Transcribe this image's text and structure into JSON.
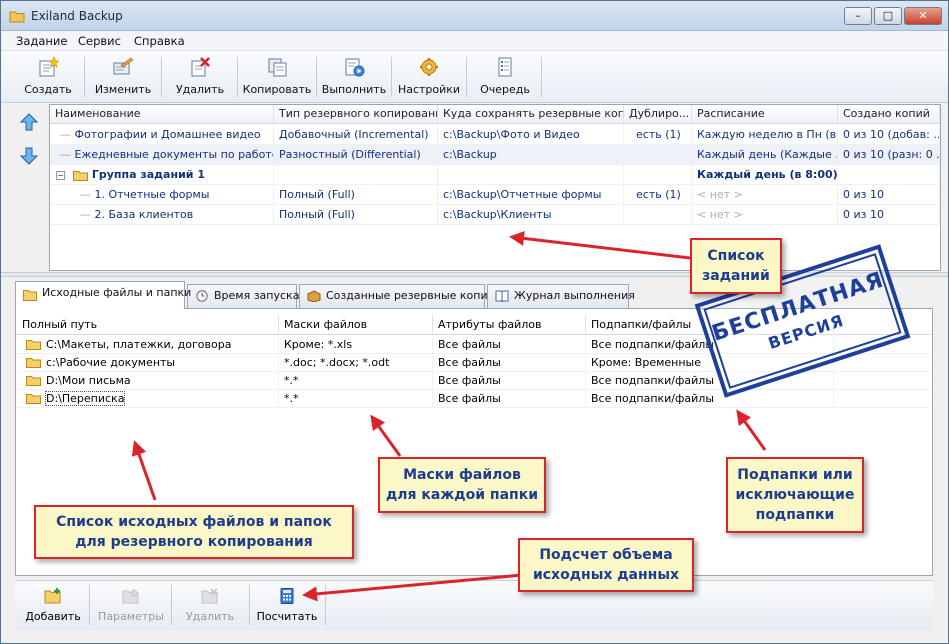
{
  "window": {
    "title": "Exiland Backup"
  },
  "menu": [
    "Задание",
    "Сервис",
    "Справка"
  ],
  "toolbar": {
    "buttons": [
      {
        "label": "Создать",
        "icon": "create-icon"
      },
      {
        "label": "Изменить",
        "icon": "edit-icon"
      },
      {
        "label": "Удалить",
        "icon": "delete-icon"
      },
      {
        "label": "Копировать",
        "icon": "copy-icon"
      },
      {
        "label": "Выполнить",
        "icon": "run-icon"
      },
      {
        "label": "Настройки",
        "icon": "settings-icon"
      },
      {
        "label": "Очередь",
        "icon": "queue-icon"
      }
    ]
  },
  "jobs": {
    "columns": [
      "Наименование",
      "Тип резервного копирования",
      "Куда сохранять резервные копии",
      "Дублиро...",
      "Расписание",
      "Создано копий"
    ],
    "rows": [
      {
        "name": "Фотографии и Домашнее видео",
        "type": "Добавочный (Incremental)",
        "dest": "c:\\Backup\\Фото и Видео",
        "dup": "есть (1)",
        "schedule": "Каждую неделю в Пн (в...",
        "copies": "0 из 10 (добав: ..."
      },
      {
        "name": "Ежедневные документы по работе",
        "type": "Разностный (Differential)",
        "dest": "c:\\Backup",
        "dup": "",
        "schedule": "Каждый день (Каждые ...",
        "copies": "0 из 10 (разн: 0 ..."
      },
      {
        "name": "Группа заданий 1",
        "type": "",
        "dest": "",
        "dup": "",
        "schedule": "Каждый день (в 8:00)",
        "copies": ""
      },
      {
        "name": "1. Отчетные формы",
        "type": "Полный (Full)",
        "dest": "c:\\Backup\\Отчетные формы",
        "dup": "есть (1)",
        "schedule": "< нет >",
        "copies": "0 из 10"
      },
      {
        "name": "2. База клиентов",
        "type": "Полный (Full)",
        "dest": "c:\\Backup\\Клиенты",
        "dup": "",
        "schedule": "< нет >",
        "copies": "0 из 10"
      }
    ]
  },
  "tabs": [
    "Исходные файлы и папки",
    "Время запуска",
    "Созданные резервные копии",
    "Журнал выполнения"
  ],
  "files": {
    "columns": [
      "Полный путь",
      "Маски файлов",
      "Атрибуты файлов",
      "Подпапки/файлы"
    ],
    "rows": [
      {
        "path": "C:\\Макеты, платежки, договора",
        "mask": "Кроме: *.xls",
        "attrs": "Все файлы",
        "sub": "Все подпапки/файлы"
      },
      {
        "path": "c:\\Рабочие документы",
        "mask": "*.doc; *.docx; *.odt",
        "attrs": "Все файлы",
        "sub": "Кроме: Временные"
      },
      {
        "path": "D:\\Мои письма",
        "mask": "*.*",
        "attrs": "Все файлы",
        "sub": "Все подпапки/файлы"
      },
      {
        "path": "D:\\Переписка",
        "mask": "*.*",
        "attrs": "Все файлы",
        "sub": "Все подпапки/файлы"
      }
    ]
  },
  "bottom_toolbar": [
    "Добавить",
    "Параметры",
    "Удалить",
    "Посчитать"
  ],
  "callouts": {
    "jobs_list": "Список\nзаданий",
    "masks": "Маски файлов\nдля каждой папки",
    "subfolders": "Подпапки или\nисключающие\nподпапки",
    "sources": "Список исходных файлов  и папок\nдля резервного копирования",
    "count": "Подсчет объема\nисходных данных"
  },
  "stamp": {
    "line1": "БЕСПЛАТНАЯ",
    "line2": "ВЕРСИЯ"
  },
  "colors": {
    "callout_bg": "#fbf7c6",
    "callout_border": "#d9242a",
    "callout_text": "#1c3c8f",
    "stamp": "#1f3f9c",
    "tree_text": "#14307a"
  }
}
